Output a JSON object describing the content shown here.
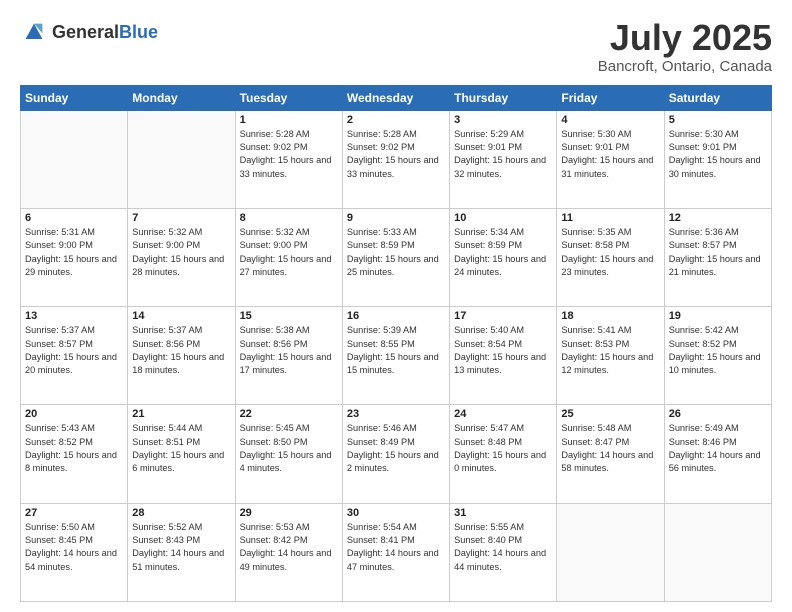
{
  "header": {
    "logo_general": "General",
    "logo_blue": "Blue",
    "month_title": "July 2025",
    "location": "Bancroft, Ontario, Canada"
  },
  "days_of_week": [
    "Sunday",
    "Monday",
    "Tuesday",
    "Wednesday",
    "Thursday",
    "Friday",
    "Saturday"
  ],
  "weeks": [
    [
      {
        "day": "",
        "info": ""
      },
      {
        "day": "",
        "info": ""
      },
      {
        "day": "1",
        "info": "Sunrise: 5:28 AM\nSunset: 9:02 PM\nDaylight: 15 hours\nand 33 minutes."
      },
      {
        "day": "2",
        "info": "Sunrise: 5:28 AM\nSunset: 9:02 PM\nDaylight: 15 hours\nand 33 minutes."
      },
      {
        "day": "3",
        "info": "Sunrise: 5:29 AM\nSunset: 9:01 PM\nDaylight: 15 hours\nand 32 minutes."
      },
      {
        "day": "4",
        "info": "Sunrise: 5:30 AM\nSunset: 9:01 PM\nDaylight: 15 hours\nand 31 minutes."
      },
      {
        "day": "5",
        "info": "Sunrise: 5:30 AM\nSunset: 9:01 PM\nDaylight: 15 hours\nand 30 minutes."
      }
    ],
    [
      {
        "day": "6",
        "info": "Sunrise: 5:31 AM\nSunset: 9:00 PM\nDaylight: 15 hours\nand 29 minutes."
      },
      {
        "day": "7",
        "info": "Sunrise: 5:32 AM\nSunset: 9:00 PM\nDaylight: 15 hours\nand 28 minutes."
      },
      {
        "day": "8",
        "info": "Sunrise: 5:32 AM\nSunset: 9:00 PM\nDaylight: 15 hours\nand 27 minutes."
      },
      {
        "day": "9",
        "info": "Sunrise: 5:33 AM\nSunset: 8:59 PM\nDaylight: 15 hours\nand 25 minutes."
      },
      {
        "day": "10",
        "info": "Sunrise: 5:34 AM\nSunset: 8:59 PM\nDaylight: 15 hours\nand 24 minutes."
      },
      {
        "day": "11",
        "info": "Sunrise: 5:35 AM\nSunset: 8:58 PM\nDaylight: 15 hours\nand 23 minutes."
      },
      {
        "day": "12",
        "info": "Sunrise: 5:36 AM\nSunset: 8:57 PM\nDaylight: 15 hours\nand 21 minutes."
      }
    ],
    [
      {
        "day": "13",
        "info": "Sunrise: 5:37 AM\nSunset: 8:57 PM\nDaylight: 15 hours\nand 20 minutes."
      },
      {
        "day": "14",
        "info": "Sunrise: 5:37 AM\nSunset: 8:56 PM\nDaylight: 15 hours\nand 18 minutes."
      },
      {
        "day": "15",
        "info": "Sunrise: 5:38 AM\nSunset: 8:56 PM\nDaylight: 15 hours\nand 17 minutes."
      },
      {
        "day": "16",
        "info": "Sunrise: 5:39 AM\nSunset: 8:55 PM\nDaylight: 15 hours\nand 15 minutes."
      },
      {
        "day": "17",
        "info": "Sunrise: 5:40 AM\nSunset: 8:54 PM\nDaylight: 15 hours\nand 13 minutes."
      },
      {
        "day": "18",
        "info": "Sunrise: 5:41 AM\nSunset: 8:53 PM\nDaylight: 15 hours\nand 12 minutes."
      },
      {
        "day": "19",
        "info": "Sunrise: 5:42 AM\nSunset: 8:52 PM\nDaylight: 15 hours\nand 10 minutes."
      }
    ],
    [
      {
        "day": "20",
        "info": "Sunrise: 5:43 AM\nSunset: 8:52 PM\nDaylight: 15 hours\nand 8 minutes."
      },
      {
        "day": "21",
        "info": "Sunrise: 5:44 AM\nSunset: 8:51 PM\nDaylight: 15 hours\nand 6 minutes."
      },
      {
        "day": "22",
        "info": "Sunrise: 5:45 AM\nSunset: 8:50 PM\nDaylight: 15 hours\nand 4 minutes."
      },
      {
        "day": "23",
        "info": "Sunrise: 5:46 AM\nSunset: 8:49 PM\nDaylight: 15 hours\nand 2 minutes."
      },
      {
        "day": "24",
        "info": "Sunrise: 5:47 AM\nSunset: 8:48 PM\nDaylight: 15 hours\nand 0 minutes."
      },
      {
        "day": "25",
        "info": "Sunrise: 5:48 AM\nSunset: 8:47 PM\nDaylight: 14 hours\nand 58 minutes."
      },
      {
        "day": "26",
        "info": "Sunrise: 5:49 AM\nSunset: 8:46 PM\nDaylight: 14 hours\nand 56 minutes."
      }
    ],
    [
      {
        "day": "27",
        "info": "Sunrise: 5:50 AM\nSunset: 8:45 PM\nDaylight: 14 hours\nand 54 minutes."
      },
      {
        "day": "28",
        "info": "Sunrise: 5:52 AM\nSunset: 8:43 PM\nDaylight: 14 hours\nand 51 minutes."
      },
      {
        "day": "29",
        "info": "Sunrise: 5:53 AM\nSunset: 8:42 PM\nDaylight: 14 hours\nand 49 minutes."
      },
      {
        "day": "30",
        "info": "Sunrise: 5:54 AM\nSunset: 8:41 PM\nDaylight: 14 hours\nand 47 minutes."
      },
      {
        "day": "31",
        "info": "Sunrise: 5:55 AM\nSunset: 8:40 PM\nDaylight: 14 hours\nand 44 minutes."
      },
      {
        "day": "",
        "info": ""
      },
      {
        "day": "",
        "info": ""
      }
    ]
  ]
}
